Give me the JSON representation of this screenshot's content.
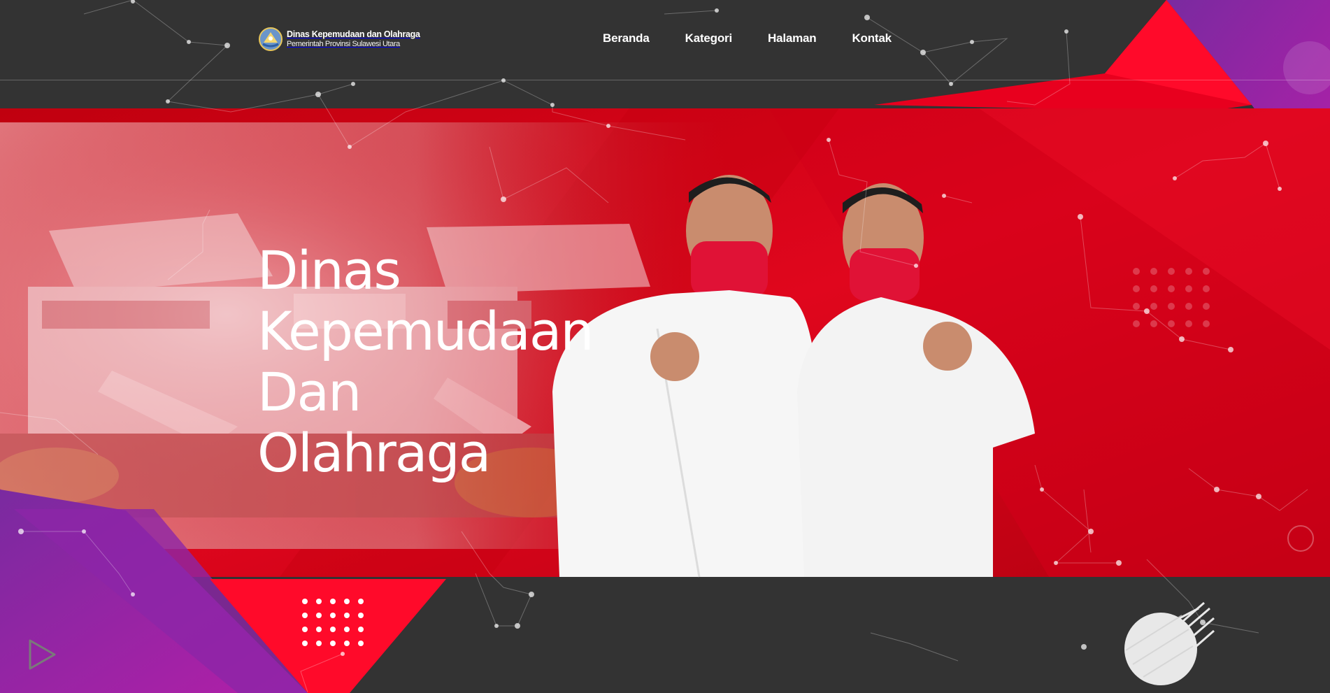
{
  "site": {
    "name": "Dinas Kepemudaan dan Olahraga",
    "subtitle": "Pemerintah Provinsi Sulawesi Utara",
    "logo_icon": "emblem-logo"
  },
  "nav": {
    "items": [
      {
        "label": "Beranda"
      },
      {
        "label": "Kategori"
      },
      {
        "label": "Halaman"
      },
      {
        "label": "Kontak"
      }
    ]
  },
  "hero": {
    "title_lines": [
      "Dinas",
      "Kepemudaan",
      "Dan",
      "Olahraga"
    ]
  },
  "decor": {
    "play_icon": "play-icon",
    "colors": {
      "background": "#333333",
      "red": "#e3001b",
      "dark_red": "#b80012",
      "purple": "#8e2aa6",
      "white": "#ffffff"
    }
  }
}
